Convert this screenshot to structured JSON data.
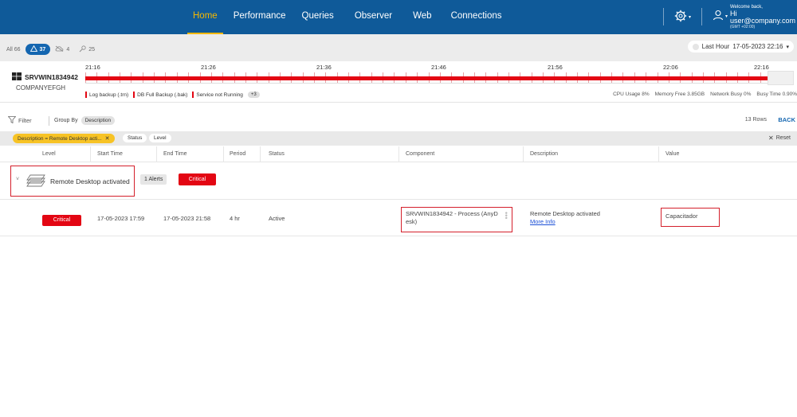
{
  "nav": {
    "links": [
      "Home",
      "Performance",
      "Queries",
      "Observer",
      "Web",
      "Connections"
    ],
    "active": "Home"
  },
  "user": {
    "welcome": "Welcome back,",
    "greeting": "Hi user@company.com",
    "timezone": "(GMT +02:00)"
  },
  "counts": {
    "all": "All 66",
    "alerts": "37",
    "cloud": "4",
    "other": "25"
  },
  "time_range": {
    "label": "Last Hour",
    "value": "17-05-2023 22:16"
  },
  "server": {
    "name": "SRVWIN1834942",
    "company": "COMPANYEFGH",
    "ticks": [
      "21:16",
      "21:26",
      "21:36",
      "21:46",
      "21:56",
      "22:06",
      "22:16"
    ],
    "legend": [
      "Log backup (.trn)",
      "DB Full Backup (.bak)",
      "Service not Running"
    ],
    "legend_more": "+3",
    "stats": {
      "cpu": "CPU Usage  8%",
      "memory": "Memory Free  3.85GB",
      "network": "Network Busy  0%",
      "busy": "Busy Time  0.90%"
    }
  },
  "filter": {
    "filter_label": "Filter",
    "group_by_label": "Group By",
    "group_by_value": "Description",
    "rows": "13 Rows",
    "back": "BACK"
  },
  "chips": {
    "active_filter": "Description = Remote Desktop acti...",
    "status": "Status",
    "level": "Level",
    "reset": "Reset"
  },
  "table": {
    "columns": [
      "Level",
      "Start Time",
      "End Time",
      "Period",
      "Status",
      "Component",
      "Description",
      "Value"
    ]
  },
  "group": {
    "label": "Remote Desktop activated",
    "alerts": "1 Alerts",
    "level": "Critical"
  },
  "row": {
    "level": "Critical",
    "start": "17-05-2023 17:59",
    "end": "17-05-2023 21:58",
    "period": "4 hr",
    "status": "Active",
    "component_line1": "SRVWIN1834942 - Process (AnyD",
    "component_line2": "esk)",
    "description": "Remote Desktop activated",
    "more_info": "More Info",
    "value": "Capacitador"
  },
  "colors": {
    "nav_bg": "#0f5a99",
    "active": "#f5b800",
    "critical": "#e30613",
    "link": "#1a4fd6"
  }
}
